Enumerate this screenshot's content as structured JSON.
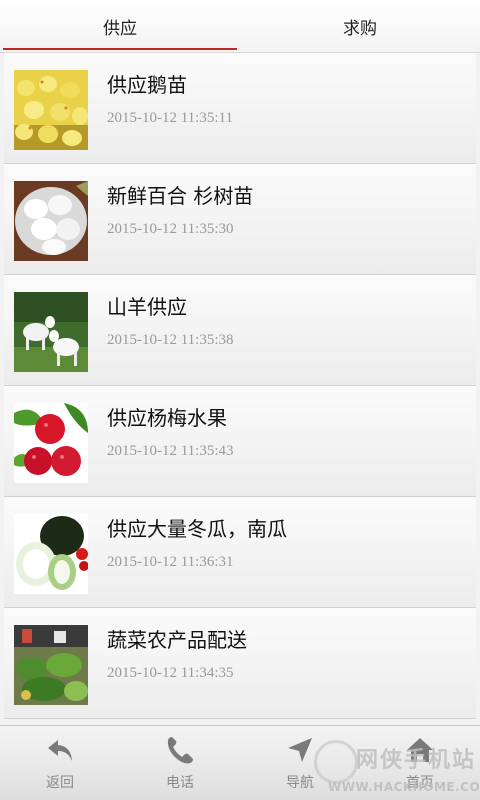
{
  "tabs": [
    {
      "label": "供应",
      "active": true
    },
    {
      "label": "求购",
      "active": false
    }
  ],
  "items": [
    {
      "title": "供应鹅苗",
      "time": "2015-10-12 11:35:11",
      "image": "goslings-photo"
    },
    {
      "title": "新鲜百合 杉树苗",
      "time": "2015-10-12 11:35:30",
      "image": "lily-bulbs-photo"
    },
    {
      "title": "山羊供应",
      "time": "2015-10-12 11:35:38",
      "image": "goats-photo"
    },
    {
      "title": "供应杨梅水果",
      "time": "2015-10-12 11:35:43",
      "image": "bayberry-photo"
    },
    {
      "title": "供应大量冬瓜，南瓜",
      "time": "2015-10-12 11:36:31",
      "image": "winter-melon-photo"
    },
    {
      "title": "蔬菜农产品配送",
      "time": "2015-10-12 11:34:35",
      "image": "vegetables-photo"
    }
  ],
  "bottom_nav": [
    {
      "label": "返回",
      "icon": "back-arrow-icon"
    },
    {
      "label": "电话",
      "icon": "phone-icon"
    },
    {
      "label": "导航",
      "icon": "navigation-icon"
    },
    {
      "label": "首页",
      "icon": "home-icon"
    }
  ],
  "watermark": {
    "text": "网侠手机站",
    "url": "WWW.HACKHOME.COM"
  },
  "colors": {
    "accent": "#c2271f",
    "time_text": "#9a9a9a",
    "nav_icon": "#7a7a7a"
  }
}
